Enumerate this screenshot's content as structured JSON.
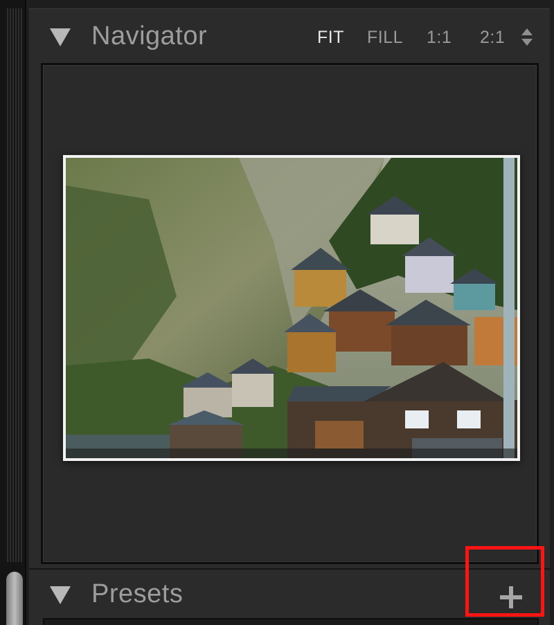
{
  "navigator": {
    "title": "Navigator",
    "zoom_options": [
      "FIT",
      "FILL",
      "1:1",
      "2:1"
    ],
    "active_zoom": "FIT"
  },
  "presets": {
    "title": "Presets"
  },
  "colors": {
    "panel_bg": "#2b2b2b",
    "header_text": "#9d9d9d",
    "active_text": "#e8e8e8",
    "highlight": "#ff1414"
  },
  "icons": {
    "navigator_toggle": "disclosure-triangle-down-icon",
    "presets_toggle": "disclosure-triangle-down-icon",
    "zoom_stepper": "up-down-arrows-icon",
    "add_preset": "plus-icon"
  }
}
